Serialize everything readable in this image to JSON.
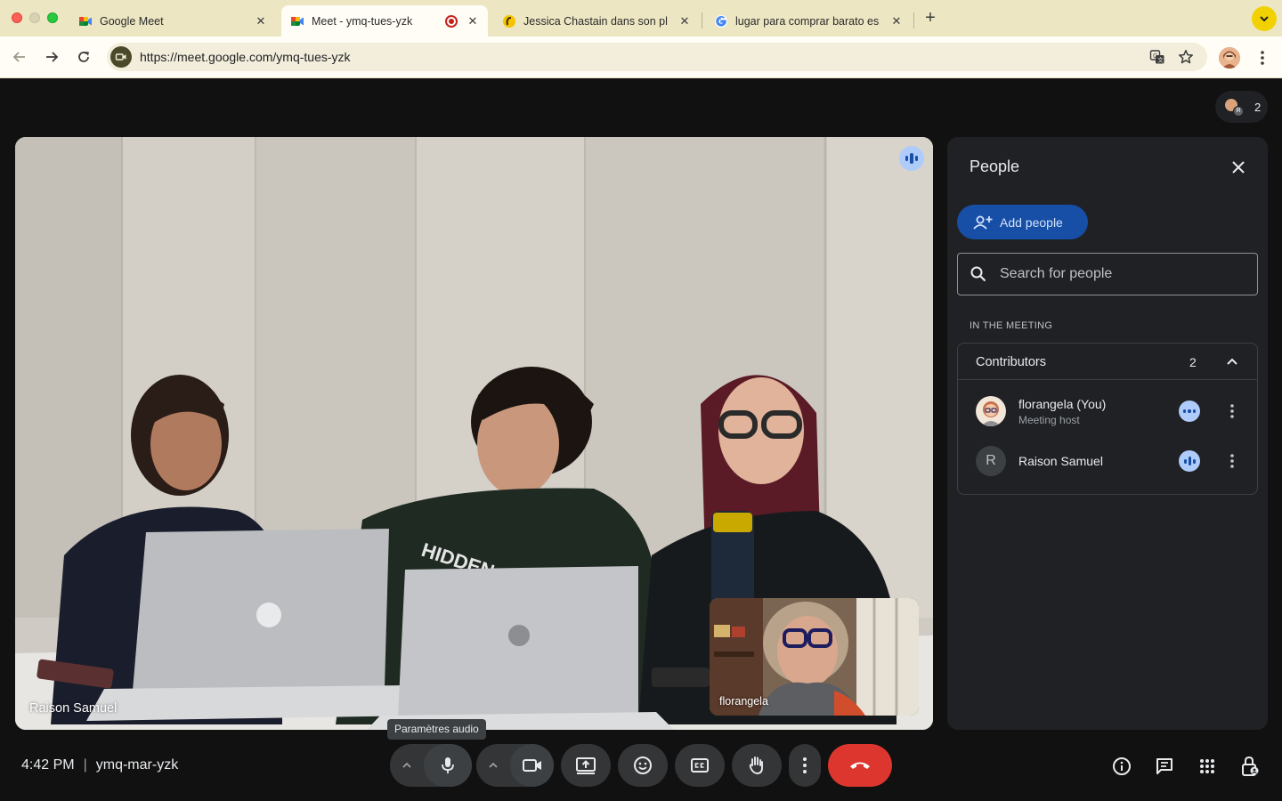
{
  "browser": {
    "tabs": [
      {
        "title": "Google Meet",
        "icon": "google-meet-icon",
        "active": false
      },
      {
        "title": "Meet - ymq-tues-yzk",
        "icon": "google-meet-icon",
        "active": true,
        "recording": true
      },
      {
        "title": "Jessica Chastain dans son pl",
        "icon": "marmiton-icon",
        "active": false
      },
      {
        "title": "lugar para comprar barato es",
        "icon": "google-g-icon",
        "active": false
      }
    ],
    "url": "https://meet.google.com/ymq-tues-yzk"
  },
  "meet": {
    "participant_count": "2",
    "main_tile": {
      "name": "Raison Samuel",
      "speaking": true
    },
    "self_tile": {
      "name": "florangela"
    },
    "people_panel": {
      "title": "People",
      "add_people_label": "Add people",
      "search_placeholder": "Search for people",
      "section_label": "IN THE MEETING",
      "group": {
        "title": "Contributors",
        "count": "2",
        "members": [
          {
            "name": "florangela (You)",
            "role": "Meeting host",
            "avatar": "photo",
            "state": "more-options"
          },
          {
            "name": "Raison Samuel",
            "role": "",
            "avatar_letter": "R",
            "state": "speaking"
          }
        ]
      }
    },
    "bottom_bar": {
      "time": "4:42 PM",
      "meeting_code": "ymq-mar-yzk",
      "tooltip": "Paramètres audio",
      "controls": [
        "audio-settings",
        "microphone",
        "video-settings",
        "camera",
        "present-screen",
        "reactions",
        "captions",
        "raise-hand",
        "more-options",
        "leave-call"
      ],
      "side_controls": [
        "meeting-details",
        "chat",
        "activities",
        "host-controls"
      ]
    }
  },
  "colors": {
    "tab_bar": "#ece6c2",
    "meet_background": "#111111",
    "panel_background": "#202124",
    "accent_blue": "#174ea6",
    "speaking_blue": "#aecbfa",
    "leave_red": "#dc362e"
  }
}
